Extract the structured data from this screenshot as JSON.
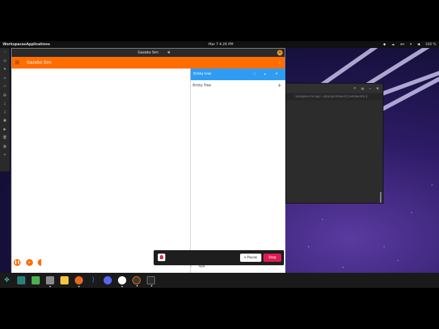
{
  "topbar": {
    "workspaces": "Workspaces",
    "applications": "Applications",
    "clock": "Mar 7  4:26 PM",
    "language": "en",
    "battery": "100 %"
  },
  "gazebo": {
    "window_title": "Gazebo Sim",
    "header_title": "Gazebo Sim",
    "panel_title": "Entity tree",
    "tree_label": "Entity Tree",
    "na_value": "N/A",
    "accent": "#ff6d00",
    "panel_color": "#2f9cf3"
  },
  "terminal": {
    "path": "kasi@kasi-ros-vgc:~/gzprojects/world_tests/worlds $"
  },
  "sharing": {
    "pause_label": "⏸ Pause",
    "stop_label": "Stop",
    "stop_color": "#e01b54"
  },
  "dock_apps": [
    "app-grid",
    "files",
    "text-editor",
    "firefox",
    "vscode",
    "discord",
    "chrome",
    "gazebo",
    "terminal"
  ]
}
